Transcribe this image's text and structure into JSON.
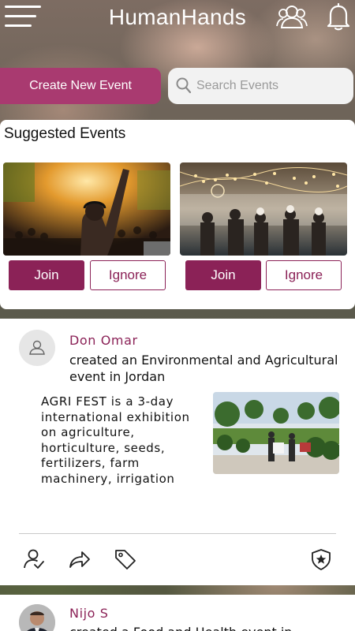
{
  "header": {
    "app_title": "HumanHands",
    "menu_icon": "hamburger-menu-icon",
    "people_icon": "users-icon",
    "bell_icon": "notification-bell-icon"
  },
  "actions": {
    "create_event_label": "Create New Event",
    "search_placeholder": "Search Events",
    "search_value": ""
  },
  "suggested": {
    "title": "Suggested Events",
    "events": [
      {
        "image": "concert-crowd-photo",
        "join_label": "Join",
        "ignore_label": "Ignore"
      },
      {
        "image": "party-string-lights-photo",
        "join_label": "Join",
        "ignore_label": "Ignore"
      }
    ]
  },
  "feed": {
    "posts": [
      {
        "author": "Don Omar",
        "action": "created an Environmental and Agricultural event in Jordan",
        "description": "AGRI FEST is a 3-day international exhibition on agriculture, horticulture, seeds, fertilizers, farm machinery, irrigation",
        "image": "plant-market-photo",
        "action_icons": [
          "user-check-icon",
          "share-icon",
          "tag-icon",
          "shield-star-icon"
        ]
      },
      {
        "author": "Nijo S",
        "action_partial": "created a Food and Health event in"
      }
    ]
  },
  "colors": {
    "primary": "#8b2257",
    "create_button": "#a93a70",
    "search_bg": "#f2f2f2",
    "card_bg": "#ffffff"
  }
}
